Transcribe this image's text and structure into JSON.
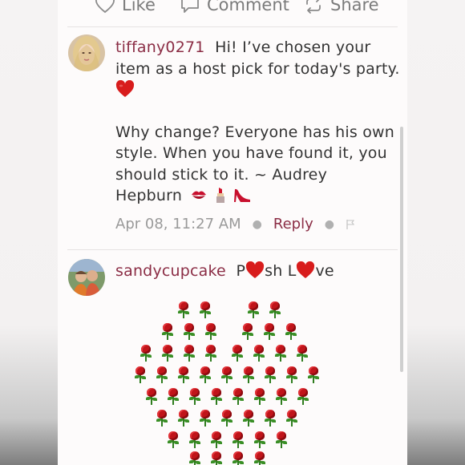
{
  "actions": {
    "like_label": "Like",
    "comment_label": "Comment",
    "share_label": "Share"
  },
  "comments": [
    {
      "username": "tiffany0271",
      "text_line1": "Hi! I’ve chosen your",
      "text_line2": "item as a host pick for today's party.",
      "text_line3": "",
      "quote_line1": "Why change? Everyone has his own",
      "quote_line2": "style. When you have found it, you",
      "quote_line3": "should stick to it. ~ Audrey",
      "quote_line4": "Hepburn",
      "timestamp": "Apr 08, 11:27 AM",
      "reply_label": "Reply",
      "avatar_icon": "avatar-blonde-woman",
      "emoji_icons": [
        "kiss-mark-icon",
        "lipstick-icon",
        "high-heel-icon"
      ]
    },
    {
      "username": "sandycupcake",
      "text_p1": "P",
      "text_p2": "sh  L",
      "text_p3": "ve",
      "avatar_icon": "avatar-couple",
      "rose_heart_icon": "rose-heart-emoji-art"
    }
  ],
  "colors": {
    "username": "#8b2d45",
    "heart": "#d81c1c",
    "rose": "#c0141a",
    "meta_gray": "#9a9a9a"
  }
}
